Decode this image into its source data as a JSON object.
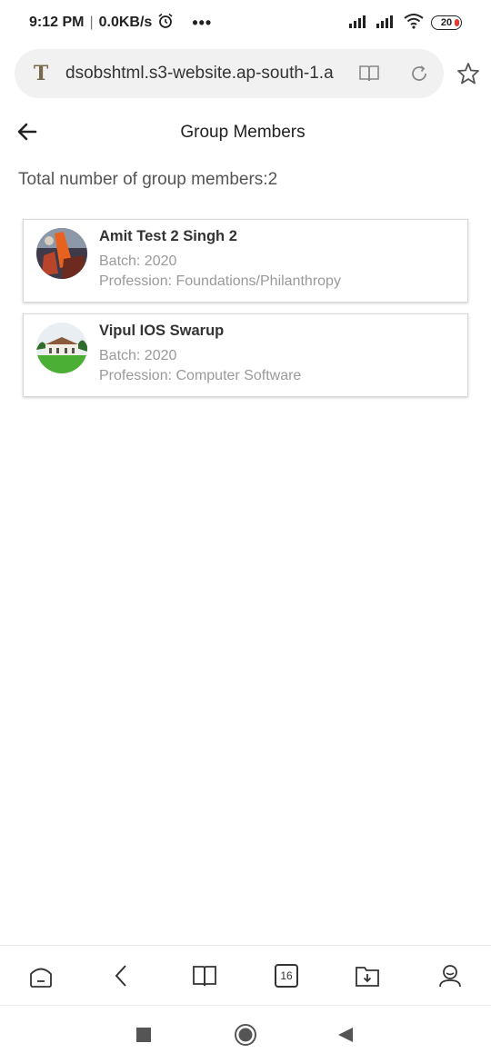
{
  "status_bar": {
    "time": "9:12 PM",
    "network_speed": "0.0KB/s",
    "more": "•••",
    "battery": "20"
  },
  "browser": {
    "url": "dsobshtml.s3-website.ap-south-1.a",
    "site_icon_letter": "T"
  },
  "header": {
    "title": "Group Members"
  },
  "summary": {
    "total_text": "Total number of group members:2"
  },
  "members": [
    {
      "name": "Amit Test 2 Singh 2",
      "batch": "Batch: 2020",
      "profession": "Profession: Foundations/Philanthropy"
    },
    {
      "name": "Vipul IOS Swarup",
      "batch": "Batch: 2020",
      "profession": "Profession: Computer Software"
    }
  ],
  "toolbar": {
    "tab_count": "16"
  },
  "colors": {
    "accent_red": "#e53935",
    "muted_text": "#9a9a9a"
  }
}
